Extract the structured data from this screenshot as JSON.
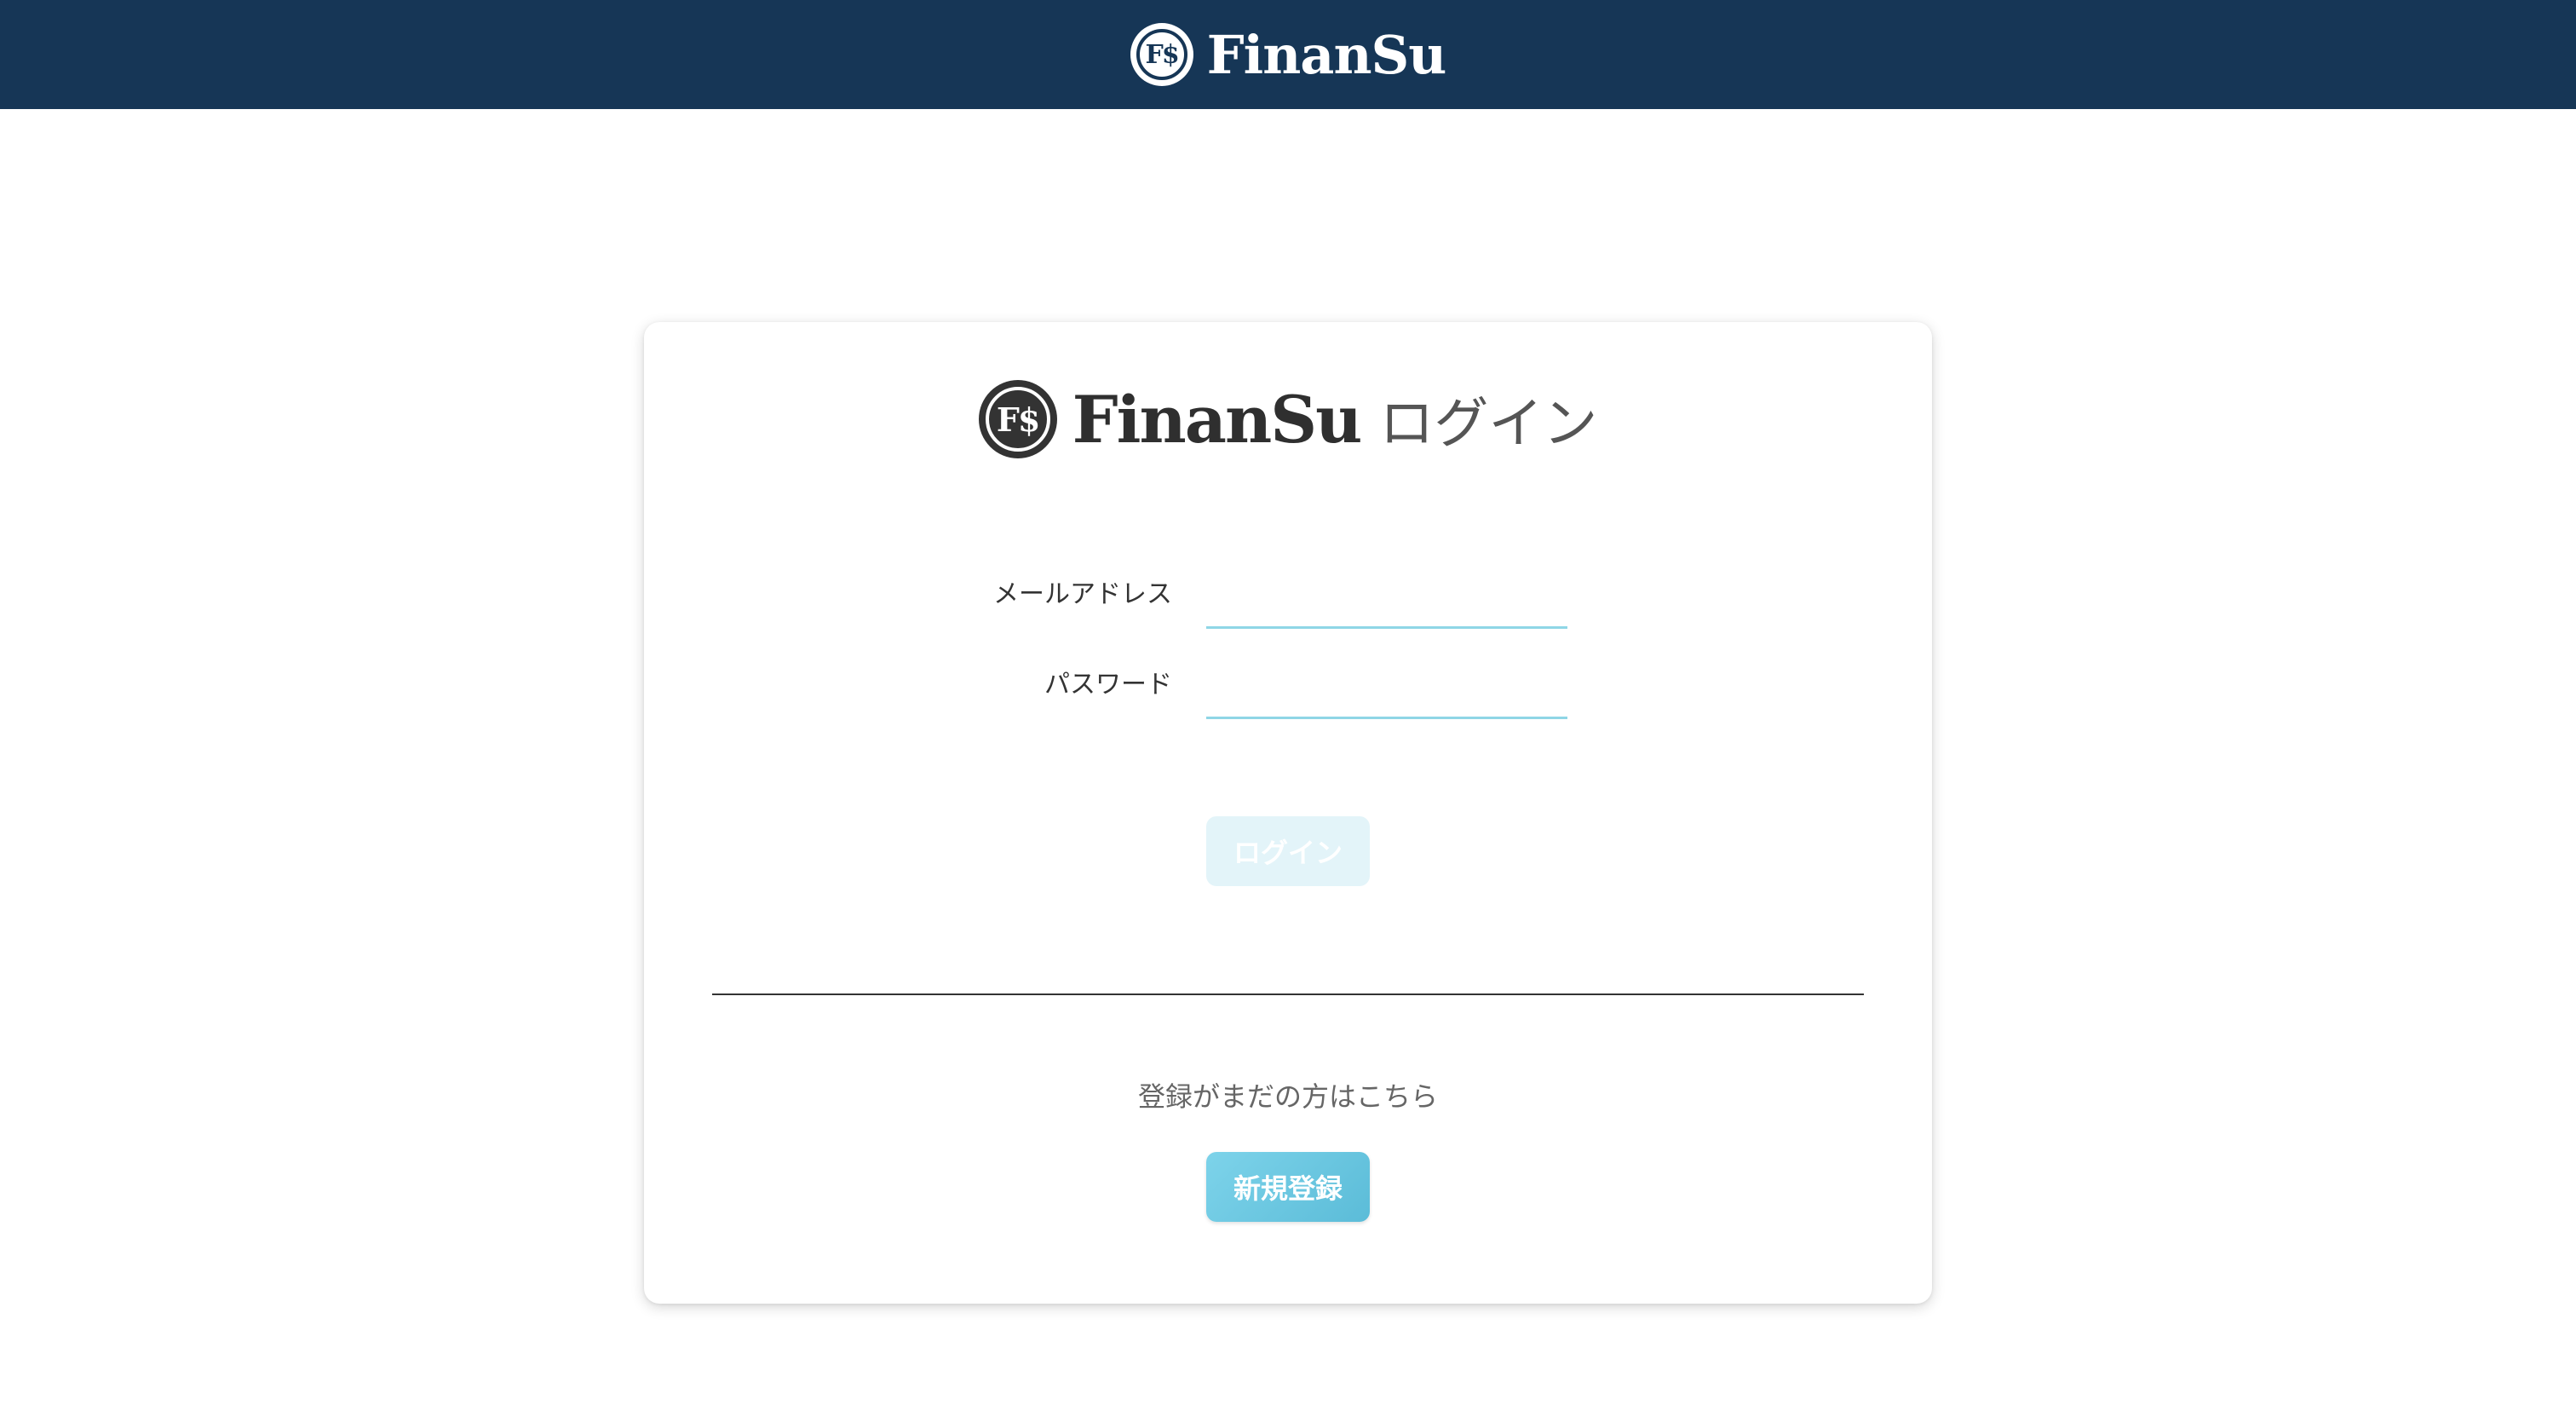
{
  "header": {
    "logo_text": "F$",
    "brand": "FinanSu"
  },
  "card": {
    "title_logo_text": "F$",
    "title_brand": "FinanSu",
    "title_suffix": "ログイン",
    "email_label": "メールアドレス",
    "email_value": "",
    "email_placeholder": "",
    "password_label": "パスワード",
    "password_value": "",
    "password_placeholder": "",
    "login_button": "ログイン",
    "register_prompt": "登録がまだの方はこちら",
    "register_button": "新規登録"
  },
  "colors": {
    "header_bg": "#163656",
    "input_underline": "#8fd6e6",
    "login_button_disabled": "#e3f4f9",
    "register_button": "#6ec8e2"
  },
  "icons": {
    "brand_logo": "finansu-logo-icon"
  }
}
